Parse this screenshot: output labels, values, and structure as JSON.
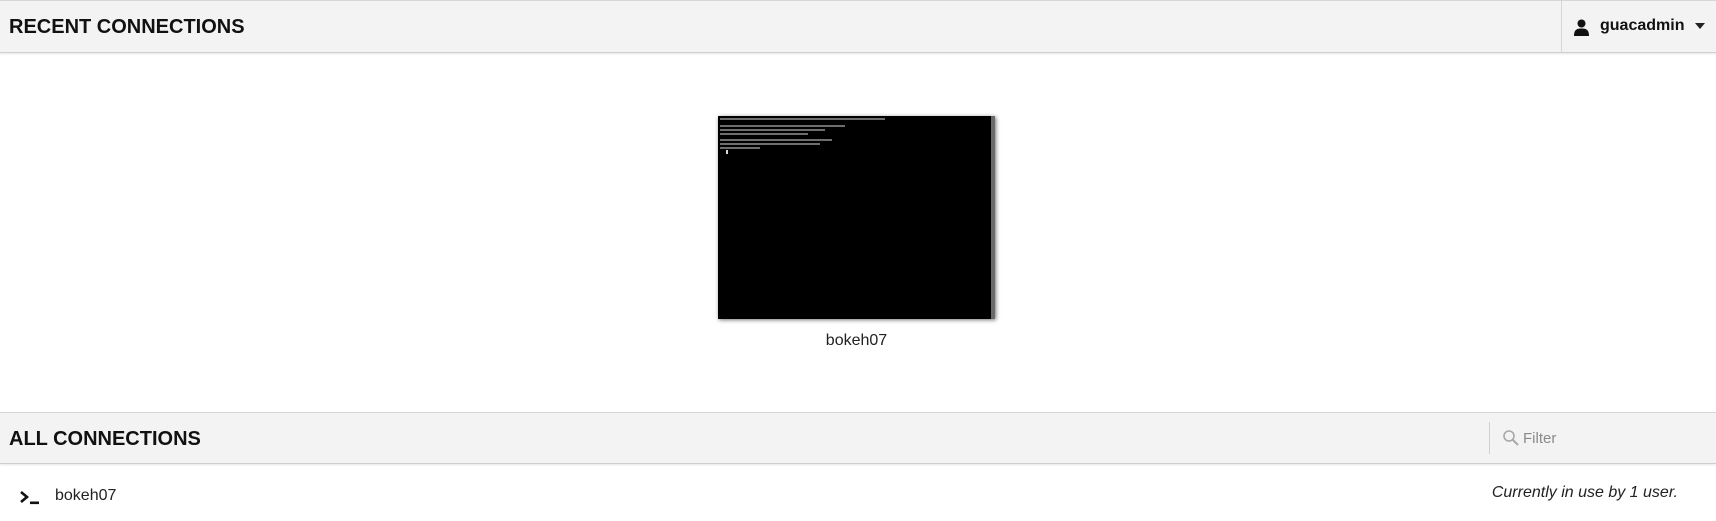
{
  "recent_section": {
    "title": "RECENT CONNECTIONS"
  },
  "user_menu": {
    "username": "guacadmin",
    "icon": "user-icon"
  },
  "recent_connections": [
    {
      "name": "bokeh07",
      "thumbnail": "terminal-screenshot"
    }
  ],
  "all_section": {
    "title": "ALL CONNECTIONS",
    "filter": {
      "placeholder": "Filter",
      "value": "",
      "icon": "search-icon"
    }
  },
  "connections": [
    {
      "name": "bokeh07",
      "icon": "terminal-icon",
      "status": "Currently in use by 1 user."
    }
  ],
  "colors": {
    "header_bg": "#f3f3f3",
    "thumbnail_bg": "#000000",
    "text": "#111111"
  }
}
